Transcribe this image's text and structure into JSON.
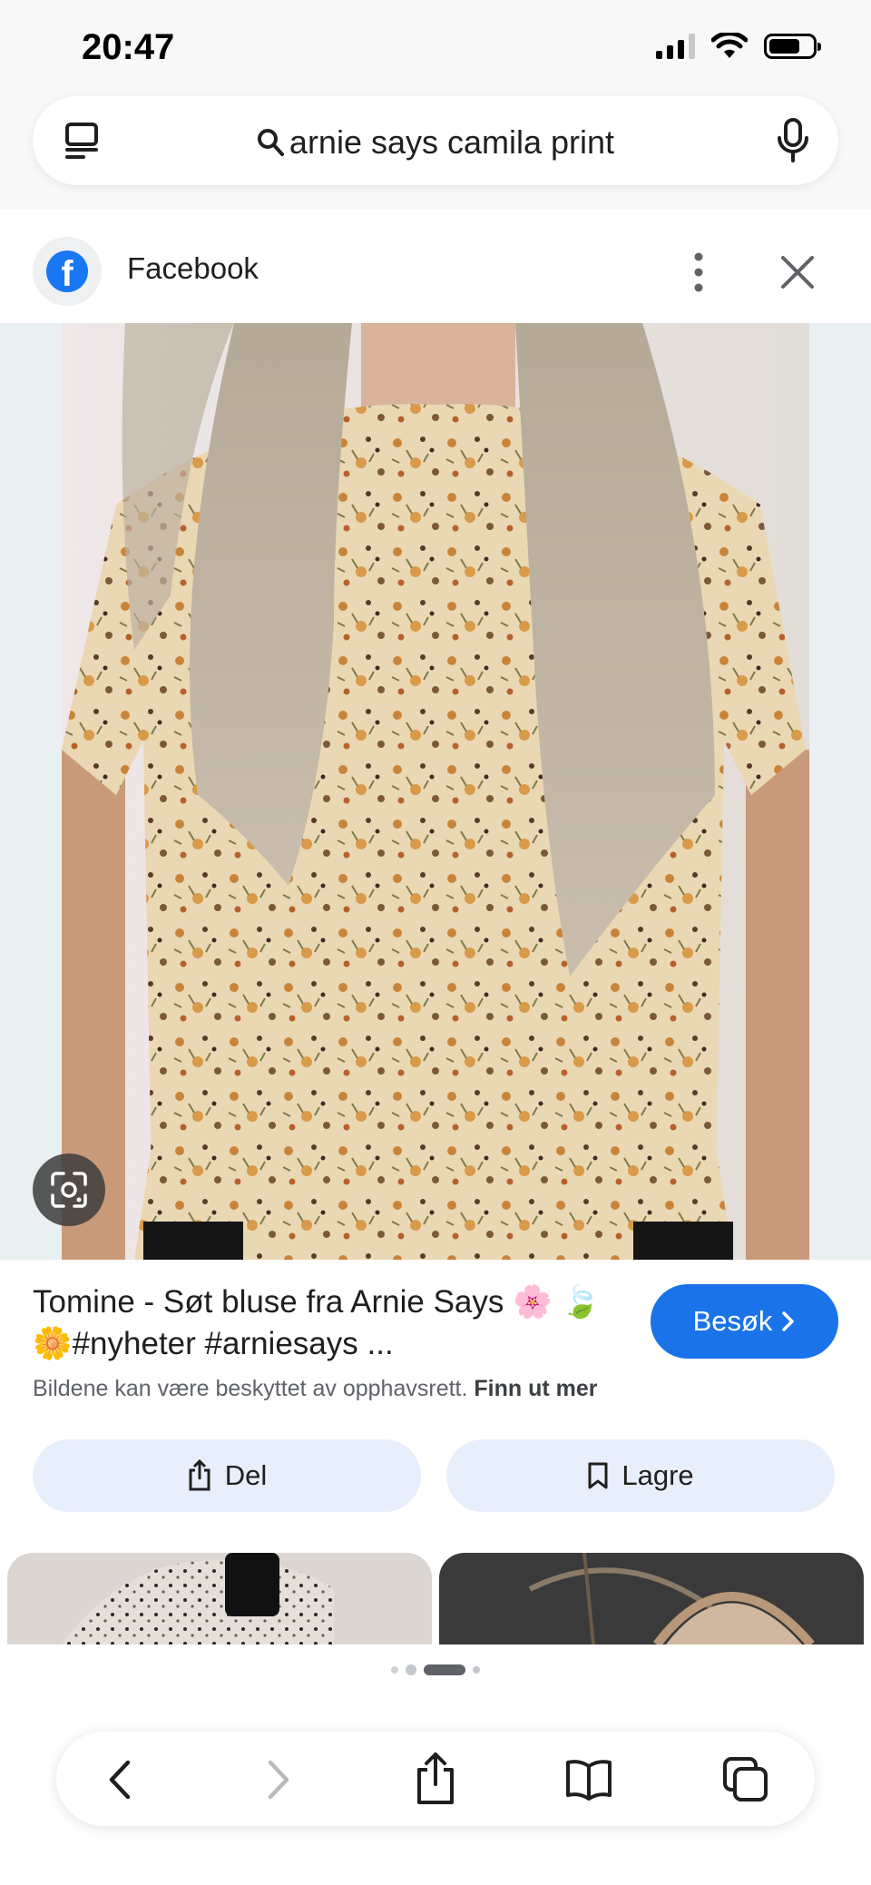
{
  "status_bar": {
    "time": "20:47"
  },
  "search": {
    "query": "arnie says camila print"
  },
  "source": {
    "name": "Facebook"
  },
  "result": {
    "title": "Tomine - Søt bluse fra Arnie Says 🌸 🍃🌼#nyheter #arniesays ...",
    "visit_label": "Besøk",
    "copyright_text": "Bildene kan være beskyttet av opphavsrett.",
    "copyright_link": "Finn ut mer"
  },
  "actions": {
    "share_label": "Del",
    "save_label": "Lagre"
  },
  "pager": {
    "active_index": 2,
    "count": 4
  },
  "icons": {
    "menu": "menu-icon",
    "search": "search-icon",
    "mic": "microphone-icon",
    "facebook": "facebook-logo",
    "more": "more-vertical-icon",
    "close": "close-icon",
    "lens": "lens-search-icon",
    "chevron": "chevron-right-icon",
    "share": "share-icon",
    "bookmark": "bookmark-icon",
    "back": "back-icon",
    "forward": "forward-icon",
    "share_nav": "share-icon",
    "bookmarks": "bookmarks-book-icon",
    "tabs": "tabs-icon"
  },
  "colors": {
    "accent": "#1a73e8",
    "button_bg": "#e8effc",
    "facebook": "#1877f2"
  }
}
